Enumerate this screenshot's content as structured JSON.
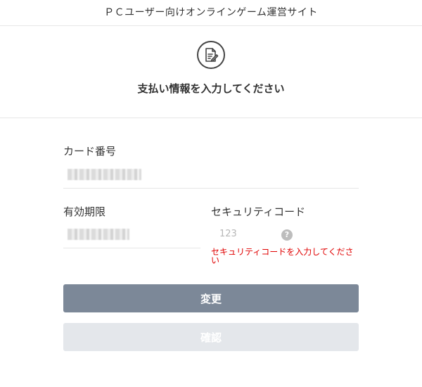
{
  "site_title": "ＰＣユーザー向けオンラインゲーム運営サイト",
  "header": {
    "icon": "edit-document-icon",
    "title": "支払い情報を入力してください"
  },
  "form": {
    "card_number_label": "カード番号",
    "expiry_label": "有効期限",
    "security_code_label": "セキュリティコード",
    "security_code_placeholder": "123",
    "help_icon_glyph": "?",
    "security_code_error": "セキュリティコードを入力してください"
  },
  "buttons": {
    "change_label": "変更",
    "confirm_label": "確認"
  },
  "colors": {
    "primary_button": "#7c8898",
    "disabled_button": "#e4e7eb",
    "error": "#e00000"
  }
}
